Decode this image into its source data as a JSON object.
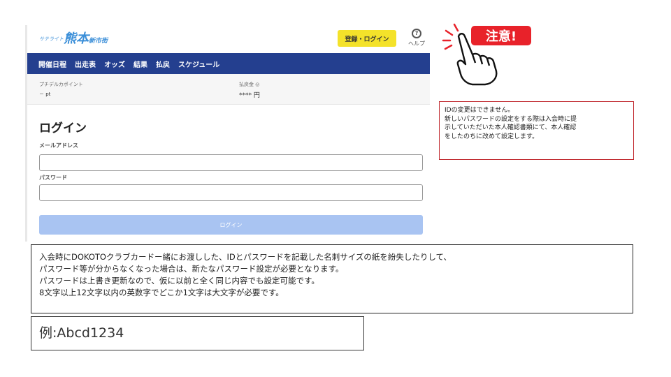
{
  "app": {
    "logo": {
      "prefix": "サテライト",
      "main": "熊本",
      "suffix": "新市街"
    },
    "header": {
      "register_login_label": "登録・ログイン",
      "help_label": "ヘルプ",
      "help_glyph": "?"
    },
    "nav": [
      {
        "label": "開催日程"
      },
      {
        "label": "出走表"
      },
      {
        "label": "オッズ"
      },
      {
        "label": "結果"
      },
      {
        "label": "払戻"
      },
      {
        "label": "スケジュール"
      }
    ],
    "points": {
      "label": "プチデルカポイント",
      "value": "－ pt",
      "refund_label": "払戻金 ◎",
      "refund_value": "**** 円"
    },
    "login": {
      "title": "ログイン",
      "email_label": "メールアドレス",
      "email_value": "",
      "password_label": "パスワード",
      "password_value": "",
      "submit_label": "ログイン"
    }
  },
  "caution": {
    "text": "注意!"
  },
  "notice": {
    "lines": [
      "IDの変更はできません。",
      "新しいパスワードの設定をする際は入会時に提",
      "示していただいた本人確認書類にて、本人確認",
      "をしたのちに改めて設定します。"
    ]
  },
  "main_text": {
    "lines": [
      "入会時にDOKOTOクラブカードー緒にお渡しした、IDとパスワードを記載した名刺サイズの紙を紛失したりして、",
      "パスワード等が分からなくなった場合は、新たなパスワード設定が必要となります。",
      "パスワードは上書き更新なので、仮に以前と全く同じ内容でも設定可能です。",
      "8文字以上12文字以内の英数字でどこか1文字は大文字が必要です。"
    ]
  },
  "example": {
    "text": "例:Abcd1234"
  },
  "colors": {
    "nav_bg": "#243f8f",
    "register_button": "#f4e22a",
    "login_button": "#a9c4f2",
    "logo": "#3a8ed8",
    "caution_red": "#e8222a",
    "notice_border": "#c0272d"
  }
}
